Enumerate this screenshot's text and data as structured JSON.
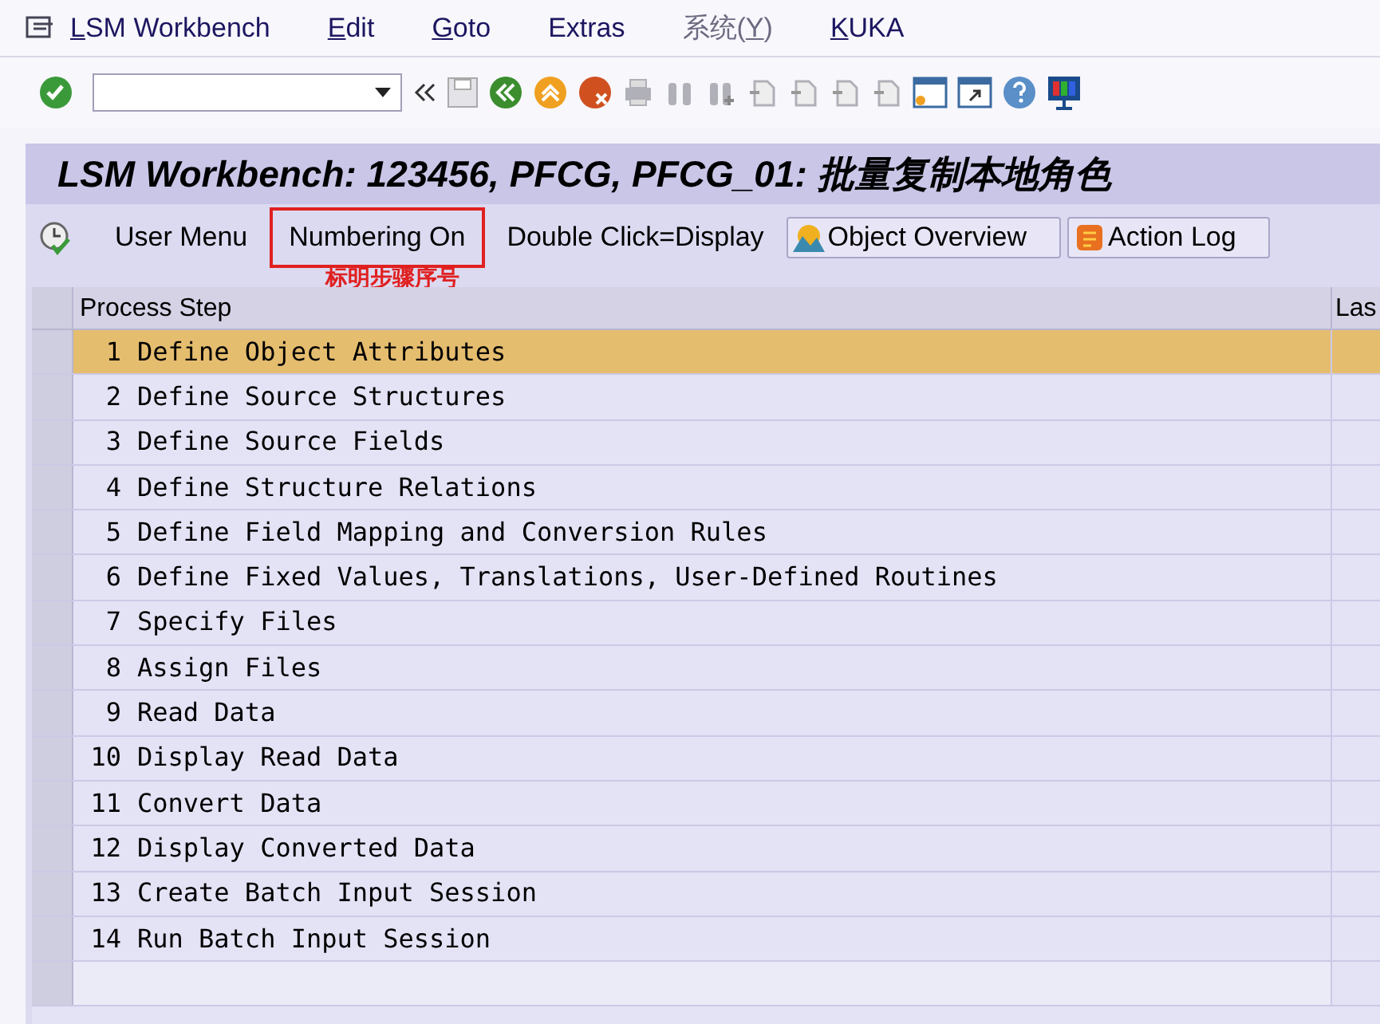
{
  "menu_bar": [
    {
      "label_parts": [
        {
          "text": "L",
          "underlined": true
        },
        {
          "text": "SM Workbench",
          "underlined": false
        }
      ],
      "disabled": false
    },
    {
      "label_parts": [
        {
          "text": "E",
          "underlined": true
        },
        {
          "text": "dit",
          "underlined": false
        }
      ],
      "disabled": false
    },
    {
      "label_parts": [
        {
          "text": "G",
          "underlined": true
        },
        {
          "text": "oto",
          "underlined": false
        }
      ],
      "disabled": false
    },
    {
      "label_parts": [
        {
          "text": "Extras",
          "underlined": false
        }
      ],
      "disabled": false
    },
    {
      "label_parts": [
        {
          "text": "系统(",
          "underlined": false
        },
        {
          "text": "Y",
          "underlined": true
        },
        {
          "text": ")",
          "underlined": false
        }
      ],
      "disabled": true
    },
    {
      "label_parts": [
        {
          "text": "K",
          "underlined": true
        },
        {
          "text": "UKA",
          "underlined": false
        }
      ],
      "disabled": false
    }
  ],
  "title": "LSM Workbench: 123456, PFCG, PFCG_01: 批量复制本地角色",
  "app_toolbar": [
    {
      "label": "User Menu",
      "kind": "flat"
    },
    {
      "label": "Numbering On",
      "kind": "flat",
      "highlighted": true
    },
    {
      "label": "Double Click=Display",
      "kind": "flat"
    },
    {
      "label": "Object Overview",
      "kind": "button"
    },
    {
      "label": "Action Log",
      "kind": "button"
    }
  ],
  "annotation": "标明步骤序号",
  "table": {
    "columns": [
      "Process Step",
      "Las"
    ],
    "rows": [
      {
        "number": "1",
        "step": "Define Object Attributes",
        "selected": true
      },
      {
        "number": "2",
        "step": "Define Source Structures",
        "selected": false
      },
      {
        "number": "3",
        "step": "Define Source Fields",
        "selected": false
      },
      {
        "number": "4",
        "step": "Define Structure Relations",
        "selected": false
      },
      {
        "number": "5",
        "step": "Define Field Mapping and Conversion Rules",
        "selected": false
      },
      {
        "number": "6",
        "step": "Define Fixed Values, Translations, User-Defined Routines",
        "selected": false
      },
      {
        "number": "7",
        "step": "Specify Files",
        "selected": false
      },
      {
        "number": "8",
        "step": "Assign Files",
        "selected": false
      },
      {
        "number": "9",
        "step": "Read Data",
        "selected": false
      },
      {
        "number": "10",
        "step": "Display Read Data",
        "selected": false
      },
      {
        "number": "11",
        "step": "Convert Data",
        "selected": false
      },
      {
        "number": "12",
        "step": "Display Converted Data",
        "selected": false
      },
      {
        "number": "13",
        "step": "Create Batch Input Session",
        "selected": false
      },
      {
        "number": "14",
        "step": "Run Batch Input Session",
        "selected": false
      }
    ]
  }
}
